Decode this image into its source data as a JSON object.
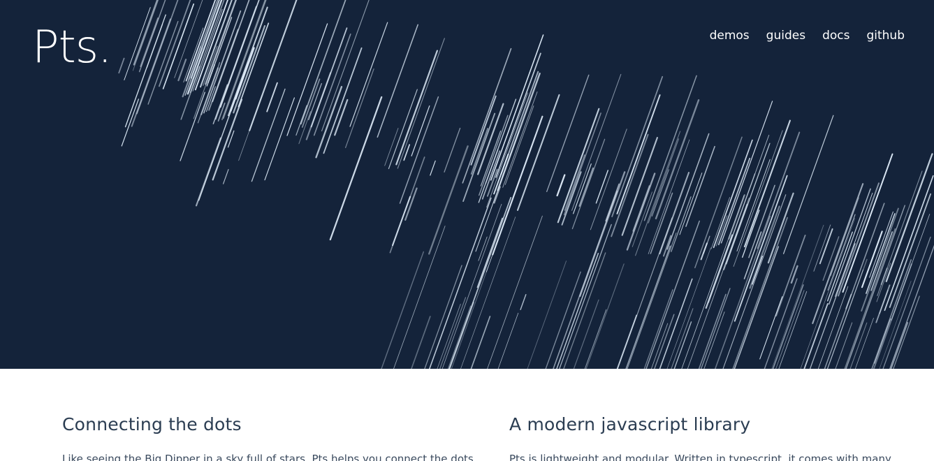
{
  "brand": {
    "logo_text": "Pts."
  },
  "nav": {
    "items": [
      {
        "label": "demos"
      },
      {
        "label": "guides"
      },
      {
        "label": "docs"
      },
      {
        "label": "github"
      }
    ]
  },
  "features": [
    {
      "title": "Connecting the dots",
      "text": "Like seeing the Big Dipper in a sky full of stars, Pts helps you connect the dots"
    },
    {
      "title": "A modern javascript library",
      "text": "Pts is lightweight and modular. Written in typescript, it comes with many"
    }
  ],
  "colors": {
    "hero_background": "#14233a",
    "line_color": "#dbe8f5",
    "heading_color": "#2b3d52",
    "text_color": "#3a4a5e"
  }
}
